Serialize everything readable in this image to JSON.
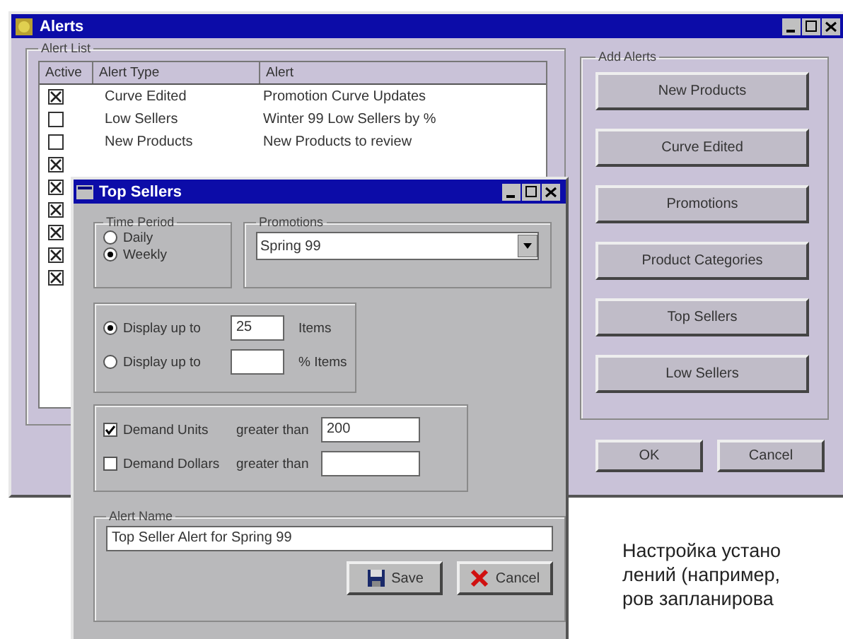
{
  "alerts_window": {
    "title": "Alerts",
    "alert_list": {
      "label": "Alert List",
      "columns": [
        "Active",
        "Alert Type",
        "Alert"
      ],
      "rows": [
        {
          "active": true,
          "type": "Curve Edited",
          "alert": "Promotion Curve Updates"
        },
        {
          "active": false,
          "type": "Low Sellers",
          "alert": "Winter 99 Low Sellers by %"
        },
        {
          "active": false,
          "type": "New Products",
          "alert": "New Products to review"
        },
        {
          "active": true
        },
        {
          "active": true
        },
        {
          "active": true
        },
        {
          "active": true
        },
        {
          "active": true
        },
        {
          "active": true
        }
      ]
    },
    "add_alerts": {
      "label": "Add Alerts",
      "buttons": [
        "New Products",
        "Curve Edited",
        "Promotions",
        "Product Categories",
        "Top Sellers",
        "Low Sellers"
      ]
    },
    "buttons": [
      "OK",
      "Cancel"
    ]
  },
  "top_sellers_dialog": {
    "title": "Top Sellers",
    "time_period": {
      "label": "Time Period",
      "options": [
        {
          "label": "Daily",
          "selected": false
        },
        {
          "label": "Weekly",
          "selected": true
        }
      ]
    },
    "promotions": {
      "label": "Promotions",
      "value": "Spring 99"
    },
    "display": [
      {
        "label": "Display up to",
        "selected": true,
        "value": "25",
        "unit": "Items"
      },
      {
        "label": "Display up to",
        "selected": false,
        "unit": "% Items"
      }
    ],
    "demand": [
      {
        "label": "Demand Units",
        "checked": true,
        "comparison": "greater than",
        "value": "200"
      },
      {
        "label": "Demand Dollars",
        "checked": false,
        "comparison": "greater than"
      }
    ],
    "alert_name": {
      "label": "Alert Name",
      "value": "Top Seller Alert for Spring 99"
    },
    "buttons": [
      {
        "kind": "save",
        "label": "Save"
      },
      {
        "kind": "cancel",
        "label": "Cancel"
      }
    ]
  },
  "caption": [
    "Настройка устано",
    "лений (например,",
    "ров запланирова"
  ]
}
